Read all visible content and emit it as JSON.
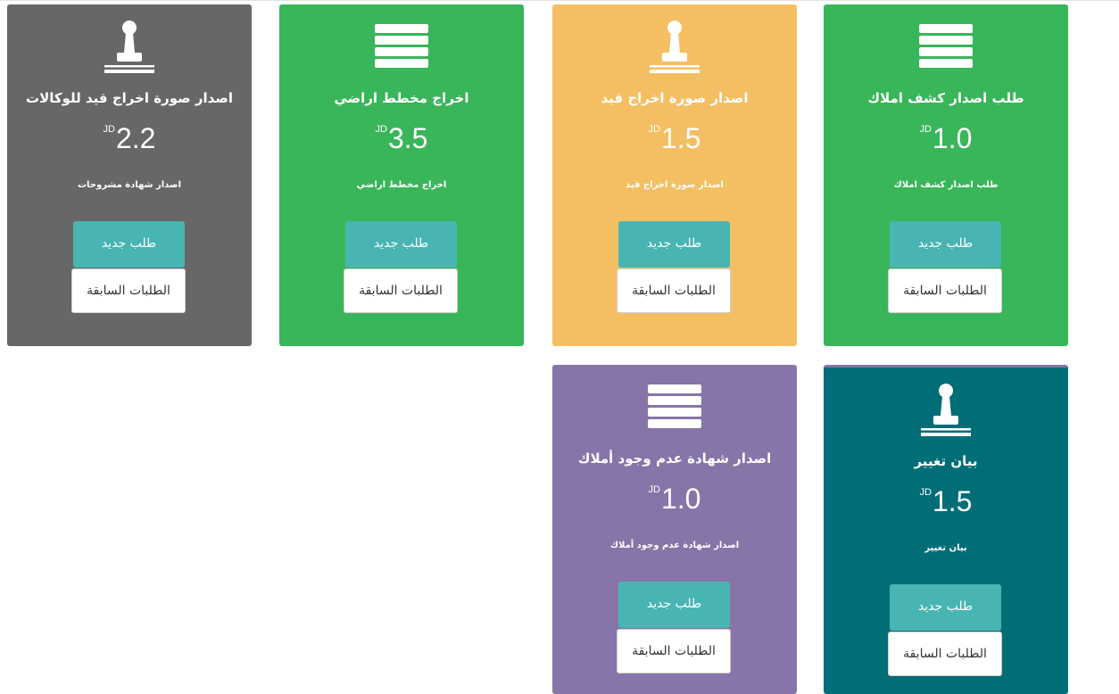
{
  "cards": [
    {
      "title": "طلب اصدار كشف املاك",
      "currency": "JD",
      "price": "1.0",
      "desc": "طلب اصدار كشف املاك",
      "new_label": "طلب جديد",
      "prev_label": "الطلبات السابقة",
      "icon": "list-icon",
      "color": "#39b55a"
    },
    {
      "title": "اصدار صورة اخراج قيد",
      "currency": "JD",
      "price": "1.5",
      "desc": "اصدار صورة اخراج قيد",
      "new_label": "طلب جديد",
      "prev_label": "الطلبات السابقة",
      "icon": "stamp-icon",
      "color": "#f4bf63"
    },
    {
      "title": "اخراج مخطط اراضي",
      "currency": "JD",
      "price": "3.5",
      "desc": "اخراج مخطط اراضي",
      "new_label": "طلب جديد",
      "prev_label": "الطلبات السابقة",
      "icon": "list-icon",
      "color": "#39b55a"
    },
    {
      "title": "اصدار صورة اخراج قيد للوكالات",
      "currency": "JD",
      "price": "2.2",
      "desc": "اصدار شهادة مشروحات",
      "new_label": "طلب جديد",
      "prev_label": "الطلبات السابقة",
      "icon": "stamp-icon",
      "color": "#686767"
    },
    {
      "title": "بيان تغيير",
      "currency": "JD",
      "price": "1.5",
      "desc": "بيان تغيير",
      "new_label": "طلب جديد",
      "prev_label": "الطلبات السابقة",
      "icon": "stamp-icon",
      "color": "#006d77"
    },
    {
      "title": "اصدار شهادة عدم وجود أملاك",
      "currency": "JD",
      "price": "1.0",
      "desc": "اصدار شهادة عدم وجود أملاك",
      "new_label": "طلب جديد",
      "prev_label": "الطلبات السابقة",
      "icon": "list-icon",
      "color": "#8774a8"
    }
  ]
}
